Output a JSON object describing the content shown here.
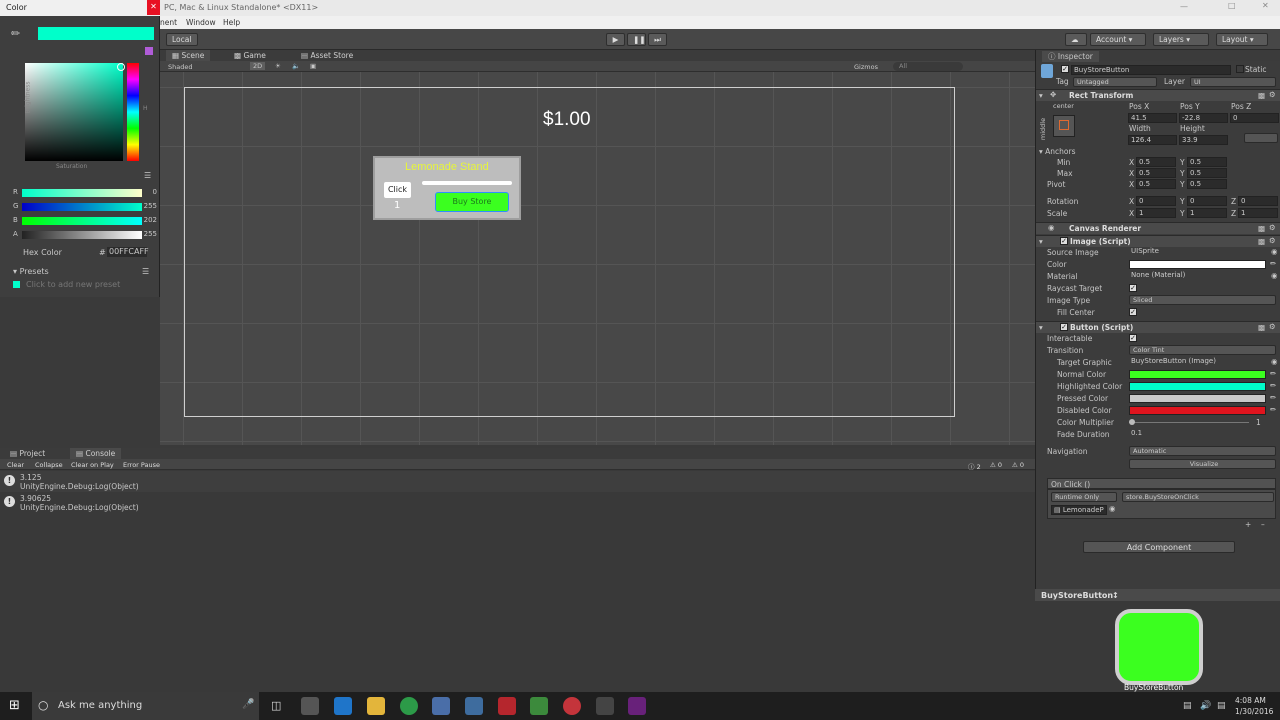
{
  "window": {
    "title": "PC, Mac & Linux Standalone* <DX11>",
    "menu": [
      "nent",
      "Window",
      "Help"
    ],
    "local_label": "Local"
  },
  "toolbar": {
    "account": "Account",
    "layers": "Layers",
    "layout": "Layout"
  },
  "scene": {
    "tabs": [
      "Scene",
      "Game",
      "Asset Store"
    ],
    "shaded": "Shaded",
    "mode2d": "2D",
    "gizmos": "Gizmos",
    "search_placeholder": "All",
    "price_text": "$1.00",
    "panel_title": "Lemonade Stand",
    "click_label": "Click",
    "count": "1",
    "buy_label": "Buy Store"
  },
  "console": {
    "tabs": [
      "Project",
      "Console"
    ],
    "buttons": [
      "Clear",
      "Collapse",
      "Clear on Play",
      "Error Pause"
    ],
    "counts": {
      "info": "2",
      "warn": "0",
      "error": "0"
    },
    "logs": [
      {
        "value": "3.125",
        "source": "UnityEngine.Debug:Log(Object)"
      },
      {
        "value": "3.90625",
        "source": "UnityEngine.Debug:Log(Object)"
      }
    ]
  },
  "color_picker": {
    "title": "Color",
    "current_color": "#00FFCA",
    "brightness_label": "Brightness",
    "saturation_label": "Saturation",
    "hue_label": "H",
    "channels": [
      {
        "label": "R",
        "value": "0"
      },
      {
        "label": "G",
        "value": "255"
      },
      {
        "label": "B",
        "value": "202"
      },
      {
        "label": "A",
        "value": "255"
      }
    ],
    "hex_label": "Hex Color",
    "hex_value": "00FFCAFF",
    "presets_label": "Presets",
    "presets_hint": "Click to add new preset"
  },
  "inspector": {
    "tab": "Inspector",
    "object_name": "BuyStoreButton",
    "static_label": "Static",
    "tag_label": "Tag",
    "tag_value": "Untagged",
    "layer_label": "Layer",
    "layer_value": "UI",
    "rect_transform": {
      "title": "Rect Transform",
      "anchor_h": "center",
      "anchor_v": "middle",
      "pos_x_label": "Pos X",
      "pos_y_label": "Pos Y",
      "pos_z_label": "Pos Z",
      "pos_x": "41.5",
      "pos_y": "-22.8",
      "pos_z": "0",
      "width_label": "Width",
      "height_label": "Height",
      "width": "126.4",
      "height": "33.9",
      "anchors_label": "Anchors",
      "min_label": "Min",
      "min_x": "0.5",
      "min_y": "0.5",
      "max_label": "Max",
      "max_x": "0.5",
      "max_y": "0.5",
      "pivot_label": "Pivot",
      "pivot_x": "0.5",
      "pivot_y": "0.5",
      "rotation_label": "Rotation",
      "rot_x": "0",
      "rot_y": "0",
      "rot_z": "0",
      "scale_label": "Scale",
      "scale_x": "1",
      "scale_y": "1",
      "scale_z": "1",
      "x": "X",
      "y": "Y",
      "z": "Z"
    },
    "canvas_renderer": "Canvas Renderer",
    "image": {
      "title": "Image (Script)",
      "source_image_label": "Source Image",
      "source_image": "UISprite",
      "color_label": "Color",
      "material_label": "Material",
      "material": "None (Material)",
      "raycast_label": "Raycast Target",
      "image_type_label": "Image Type",
      "image_type": "Sliced",
      "fill_center_label": "Fill Center"
    },
    "button": {
      "title": "Button (Script)",
      "interactable_label": "Interactable",
      "transition_label": "Transition",
      "transition": "Color Tint",
      "target_graphic_label": "Target Graphic",
      "target_graphic": "BuyStoreButton (Image)",
      "normal_label": "Normal Color",
      "highlighted_label": "Highlighted Color",
      "pressed_label": "Pressed Color",
      "disabled_label": "Disabled Color",
      "multiplier_label": "Color Multiplier",
      "multiplier": "1",
      "fade_label": "Fade Duration",
      "fade": "0.1",
      "normal_color": "#3bff1f",
      "highlighted_color": "#00ffca",
      "pressed_color": "#c8c8c8",
      "disabled_color": "#e0141e"
    },
    "navigation_label": "Navigation",
    "navigation": "Automatic",
    "visualize": "Visualize",
    "onclick": {
      "title": "On Click ()",
      "runtime": "Runtime Only",
      "function": "store.BuyStoreOnClick",
      "object": "LemonadeP"
    },
    "add_component": "Add Component",
    "preview_title": "BuyStoreButton",
    "preview_caption": "BuyStoreButton"
  },
  "taskbar": {
    "search_placeholder": "Ask me anything",
    "time": "4:08 AM",
    "date": "1/30/2016"
  }
}
